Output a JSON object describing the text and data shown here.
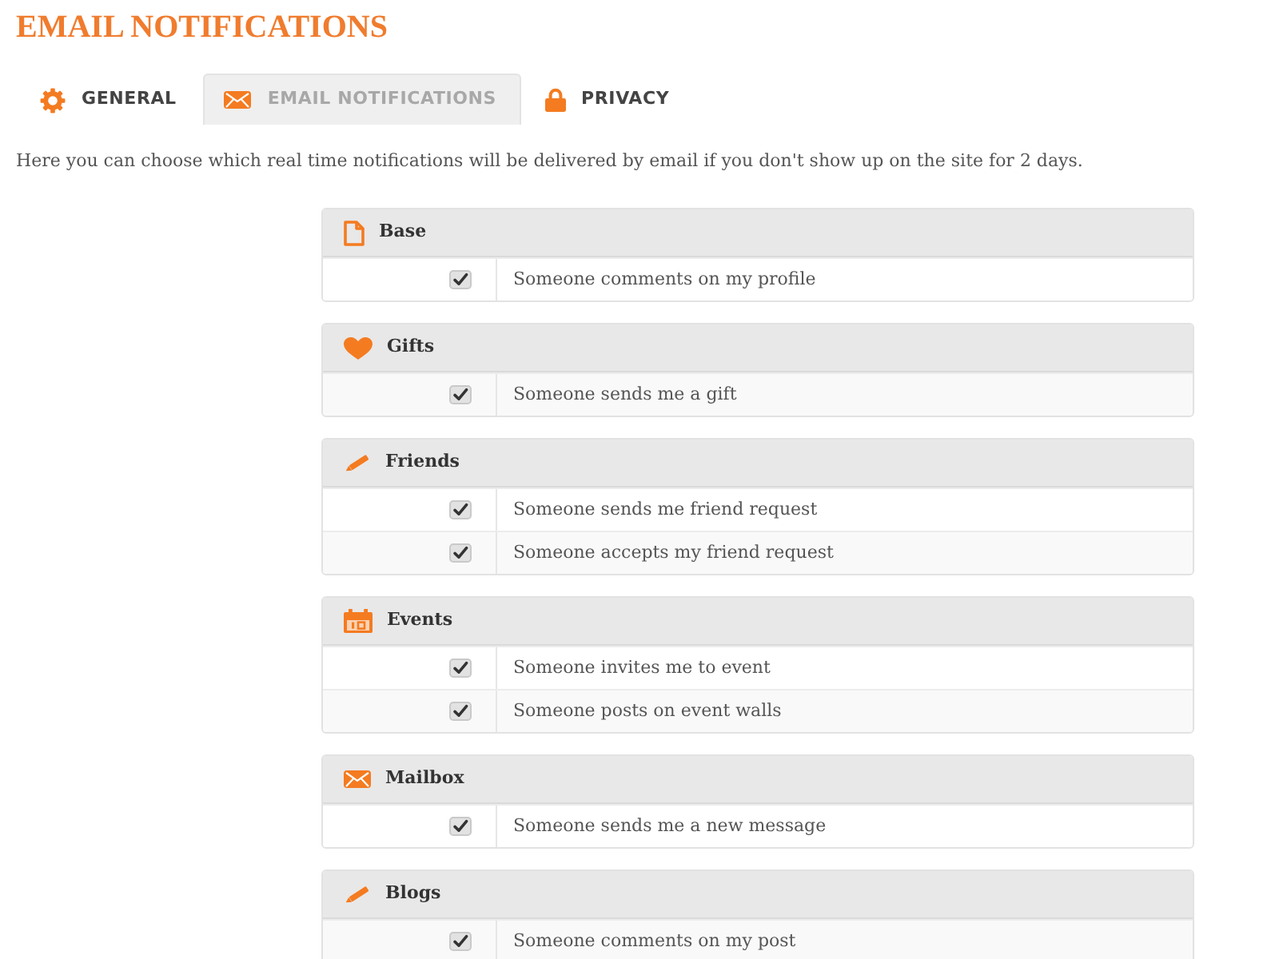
{
  "page": {
    "title": "EMAIL NOTIFICATIONS"
  },
  "tabs": [
    {
      "label": "GENERAL",
      "selected": false
    },
    {
      "label": "EMAIL NOTIFICATIONS",
      "selected": true
    },
    {
      "label": "PRIVACY",
      "selected": false
    }
  ],
  "description": "Here you can choose which real time notifications will be delivered by email if you don't show up on the site for 2 days.",
  "sections": [
    {
      "title": "Base",
      "items": [
        {
          "label": "Someone comments on my profile",
          "checked": true
        }
      ]
    },
    {
      "title": "Gifts",
      "items": [
        {
          "label": "Someone sends me a gift",
          "checked": true
        }
      ]
    },
    {
      "title": "Friends",
      "items": [
        {
          "label": "Someone sends me friend request",
          "checked": true
        },
        {
          "label": "Someone accepts my friend request",
          "checked": true
        }
      ]
    },
    {
      "title": "Events",
      "items": [
        {
          "label": "Someone invites me to event",
          "checked": true
        },
        {
          "label": "Someone posts on event walls",
          "checked": true
        }
      ]
    },
    {
      "title": "Mailbox",
      "items": [
        {
          "label": "Someone sends me a new message",
          "checked": true
        }
      ]
    },
    {
      "title": "Blogs",
      "items": [
        {
          "label": "Someone comments on my post",
          "checked": true
        }
      ]
    }
  ]
}
